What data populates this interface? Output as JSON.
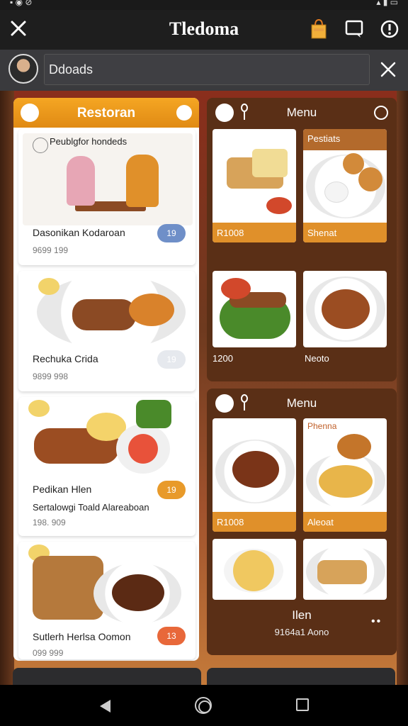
{
  "app": {
    "title": "Tledoma"
  },
  "search": {
    "value": "Ddoads"
  },
  "left_panel": {
    "title": "Restoran",
    "cards": [
      {
        "caption": "Peublgfor hondeds",
        "name": "Dasonikan Kodaroan",
        "price": "9699 199",
        "badge": "19",
        "badge_color": "#6f8fc8"
      },
      {
        "name": "Rechuka Crida",
        "price": "9899 998",
        "badge": "19",
        "badge_color": "#e6e9ee"
      },
      {
        "name": "Pedikan Hlen",
        "sub": "Sertalowgi Toald Alareaboan",
        "price": "198. 909",
        "badge": "19",
        "badge_color": "#e89a2a"
      },
      {
        "name": "Sutlerh Herlsa Oomon",
        "price": "099 999",
        "badge": "13",
        "badge_color": "#e8683a"
      }
    ]
  },
  "menu_panel_1": {
    "title": "Menu",
    "tiles": [
      {
        "label": "R1008"
      },
      {
        "top_label": "Pestiats",
        "label": "Shenat"
      },
      {
        "label": "1200"
      },
      {
        "label": "Neoto"
      }
    ]
  },
  "menu_panel_2": {
    "title": "Menu",
    "tiles": [
      {
        "label": "R1008"
      },
      {
        "top_label": "Phenna",
        "label": "Aleoat"
      }
    ],
    "footer_name": "Ilen",
    "footer_sub": "9164a1 Aono"
  },
  "colors": {
    "accent": "#e0902a",
    "panel_bg": "#5a2f16",
    "header_orange": "#f5a623"
  }
}
